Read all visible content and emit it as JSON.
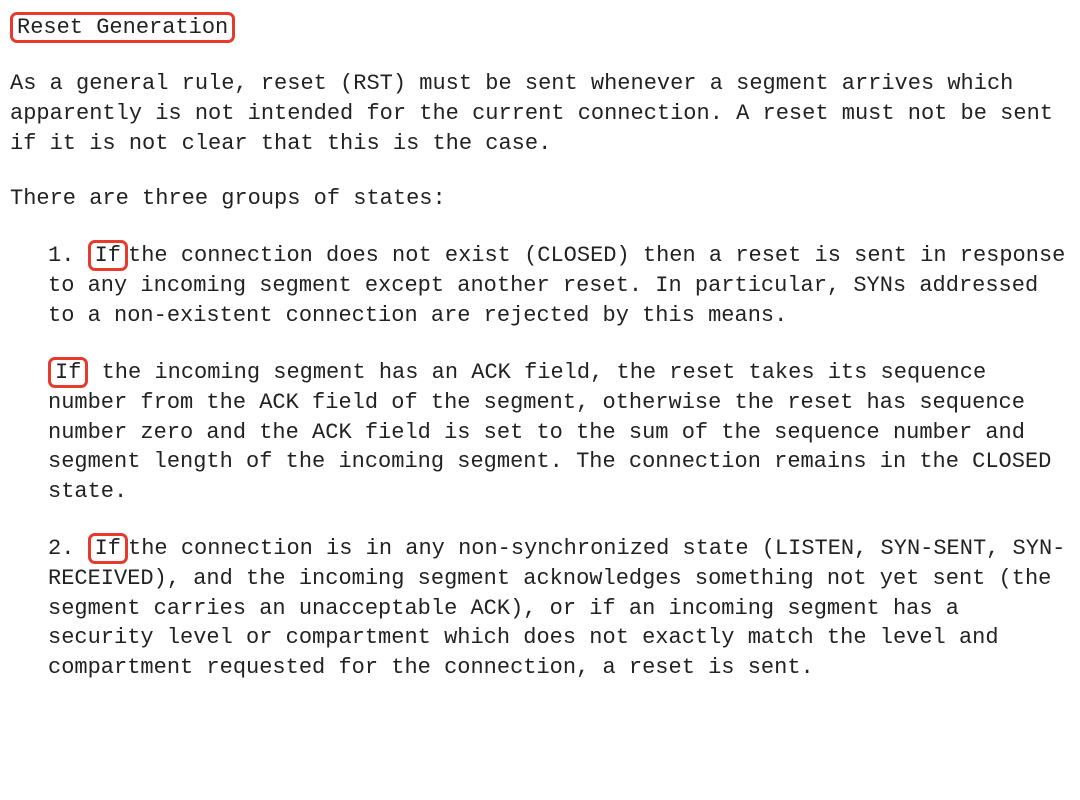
{
  "title": "Reset Generation",
  "intro_para": "As a general rule, reset (RST) must be sent whenever a segment arrives which apparently is not intended for the current connection.  A reset must not be sent if it is not clear that this is the case.",
  "groups_intro": "There are three groups of states:",
  "item1_num": "1.  ",
  "item1_hl": "If ",
  "item1_rest": "the connection does not exist (CLOSED) then a reset is sent in response to any incoming segment except another reset.  In particular, SYNs addressed to a non-existent connection are rejected by this means.",
  "item1b_hl": "If",
  "item1b_rest": " the incoming segment has an ACK field, the reset takes its sequence number from the ACK field of the segment, otherwise the reset has sequence number zero and the ACK field is set to the sum of the sequence number and segment length of the incoming segment.  The connection remains in the CLOSED state.",
  "item2_num": "2.  ",
  "item2_hl": "If ",
  "item2_rest": "the connection is in any non-synchronized state (LISTEN, SYN-SENT, SYN-RECEIVED), and the incoming segment acknowledges something not yet sent (the segment carries an unacceptable ACK), or if an incoming segment has a security level or compartment which does not exactly match the level and compartment requested for the connection, a reset is sent."
}
